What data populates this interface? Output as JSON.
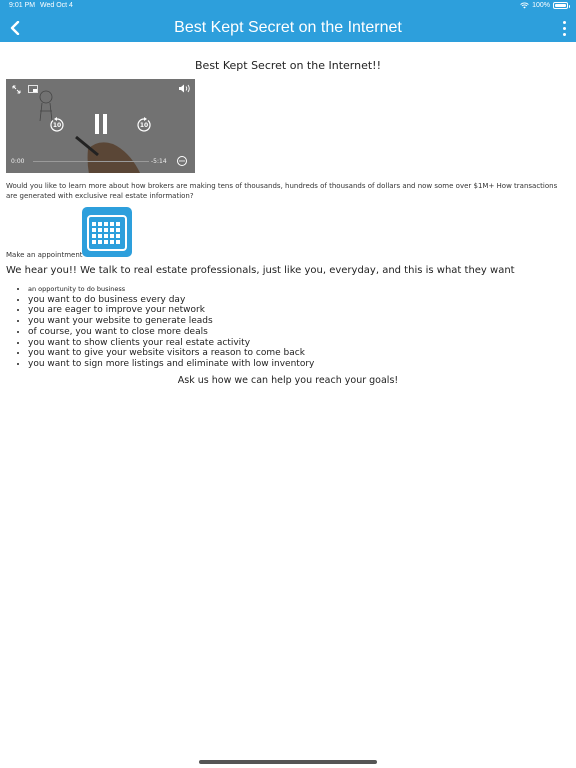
{
  "status_bar": {
    "time": "9:01 PM",
    "date": "Wed Oct 4",
    "battery": "100%",
    "battery_level": 1.0
  },
  "navbar": {
    "title": "Best Kept Secret on the Internet",
    "color": "#2d9fdc"
  },
  "heading": "Best Kept Secret on the Internet!!",
  "video": {
    "elapsed": "0:00",
    "remaining": "-5:14",
    "skip_back": "10",
    "skip_forward": "10",
    "progress": 0.0
  },
  "intro_text": "Would you like to learn more about how brokers are making tens of thousands, hundreds of thousands of dollars and now some over $1M+ How transactions are generated with exclusive real estate information?",
  "appointment_label": "Make an appointment",
  "hear_text": "We hear you!! We talk to real estate professionals, just like you, everyday, and this is what they want",
  "wants": [
    "an opportunity to do business",
    "you want to do business every day",
    "you are eager to improve your network",
    "you want your website to generate leads",
    "of course, you want to close more deals",
    "you want to show clients your real estate activity",
    "you want to give your website visitors a reason to come back",
    "you want to sign more listings and eliminate with low inventory"
  ],
  "closing": "Ask us how we can help you reach your goals!"
}
